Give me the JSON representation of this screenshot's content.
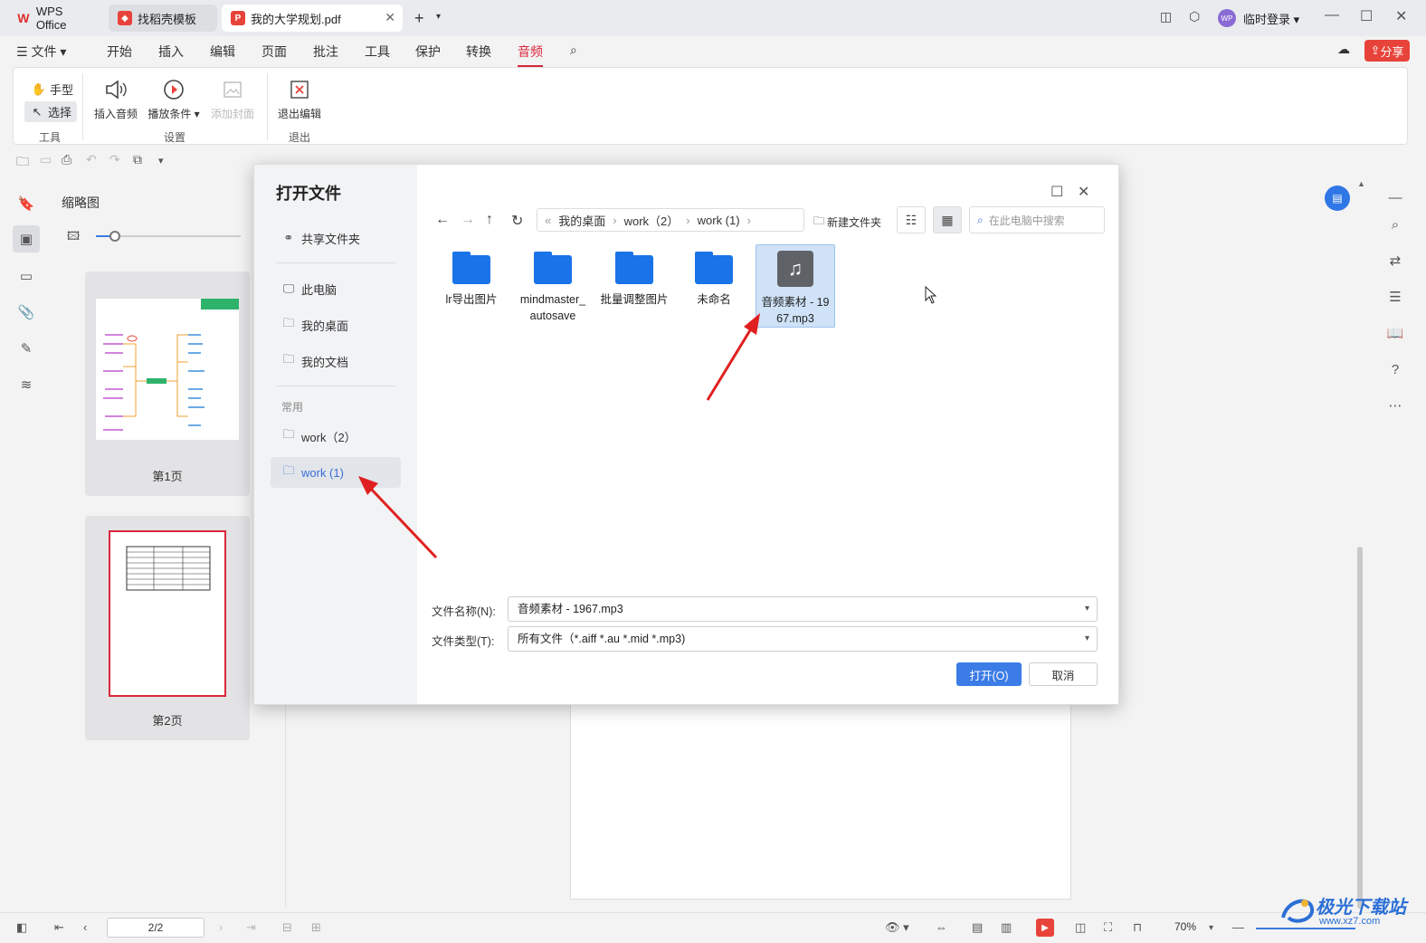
{
  "tabs": {
    "wps": "WPS Office",
    "template": "找稻壳模板",
    "pdf": "我的大学规划.pdf"
  },
  "account": {
    "avatar": "WP",
    "login": "临时登录"
  },
  "menu": {
    "file": "文件",
    "items": [
      "开始",
      "插入",
      "编辑",
      "页面",
      "批注",
      "工具",
      "保护",
      "转换",
      "音频"
    ],
    "share": "分享"
  },
  "ribbon": {
    "hand": "手型",
    "select": "选择",
    "group_tools": "工具",
    "insert_audio": "插入音频",
    "play_condition": "播放条件",
    "add_cover": "添加封面",
    "group_settings": "设置",
    "exit_edit": "退出编辑",
    "group_exit": "退出"
  },
  "thumbs": {
    "title": "缩略图",
    "page1": "第1页",
    "page2": "第2页"
  },
  "status": {
    "page_value": "2/2",
    "zoom": "70%"
  },
  "watermark": {
    "brand": "极光下载站",
    "url": "www.xz7.com"
  },
  "dialog": {
    "title": "打开文件",
    "sidebar": {
      "shared": "共享文件夹",
      "pc": "此电脑",
      "desktop": "我的桌面",
      "docs": "我的文档",
      "section": "常用",
      "work2": "work（2）",
      "work1": "work (1)"
    },
    "breadcrumb": [
      "我的桌面",
      "work（2）",
      "work (1)"
    ],
    "new_folder": "新建文件夹",
    "search_placeholder": "在此电脑中搜索",
    "files": [
      {
        "name": "lr导出图片",
        "type": "folder"
      },
      {
        "name": "mindmaster_ autosave",
        "type": "folder"
      },
      {
        "name": "批量调整图片",
        "type": "folder"
      },
      {
        "name": "未命名",
        "type": "folder"
      },
      {
        "name": "音频素材 - 19 67.mp3",
        "type": "audio"
      }
    ],
    "filename_label": "文件名称(N):",
    "filename_value": "音频素材 - 1967.mp3",
    "filetype_label": "文件类型(T):",
    "filetype_value": "所有文件（*.aiff *.au *.mid *.mp3)",
    "open_btn": "打开(O)",
    "cancel_btn": "取消"
  },
  "colors": {
    "accent": "#d9263b",
    "primary_blue": "#3b7ce6",
    "folder": "#1a73e8",
    "arrow": "#e02020"
  }
}
